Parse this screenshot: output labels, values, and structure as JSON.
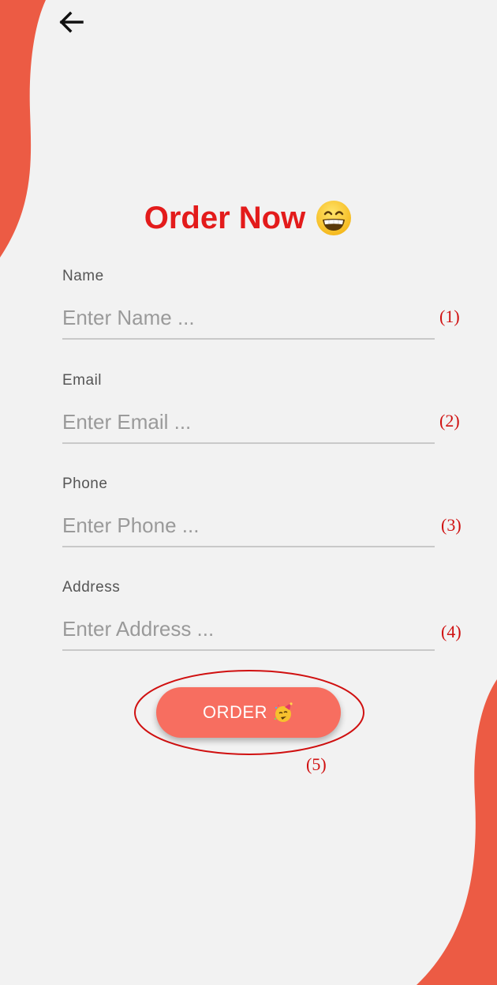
{
  "colors": {
    "blob": "#ec5b44",
    "title": "#e31b1b",
    "button": "#f76e60",
    "annotation": "#d01010"
  },
  "header": {
    "back_icon": "arrow-left-icon"
  },
  "title": {
    "text": "Order Now",
    "emoji_icon": "grinning-face-icon"
  },
  "form": {
    "fields": [
      {
        "label": "Name",
        "placeholder": "Enter Name ...",
        "value": ""
      },
      {
        "label": "Email",
        "placeholder": "Enter Email ...",
        "value": ""
      },
      {
        "label": "Phone",
        "placeholder": "Enter Phone ...",
        "value": ""
      },
      {
        "label": "Address",
        "placeholder": "Enter Address ...",
        "value": ""
      }
    ],
    "submit": {
      "label": "ORDER",
      "emoji_icon": "partying-face-icon"
    }
  },
  "annotations": [
    "(1)",
    "(2)",
    "(3)",
    "(4)",
    "(5)"
  ]
}
